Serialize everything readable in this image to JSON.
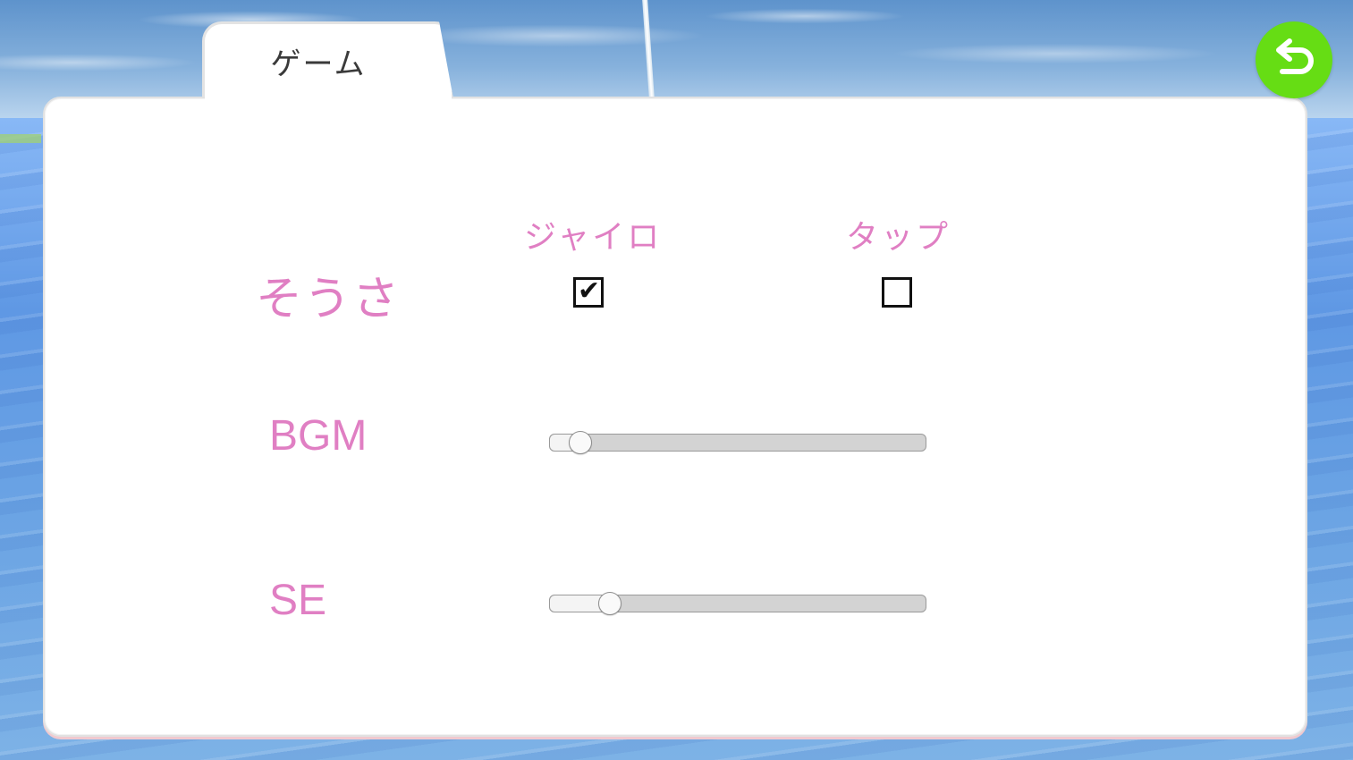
{
  "tab": {
    "label": "ゲーム"
  },
  "back_button": {
    "icon": "undo-arrow-icon",
    "color": "#66dd14"
  },
  "controls": {
    "label": "そうさ",
    "options": [
      {
        "label": "ジャイロ",
        "checked": true
      },
      {
        "label": "タップ",
        "checked": false
      }
    ]
  },
  "bgm": {
    "label": "BGM",
    "level": 0.08
  },
  "se": {
    "label": "SE",
    "level": 0.16
  },
  "colors": {
    "label_pink": "#e07fc3",
    "panel": "#ffffff",
    "back_button": "#66dd14"
  }
}
